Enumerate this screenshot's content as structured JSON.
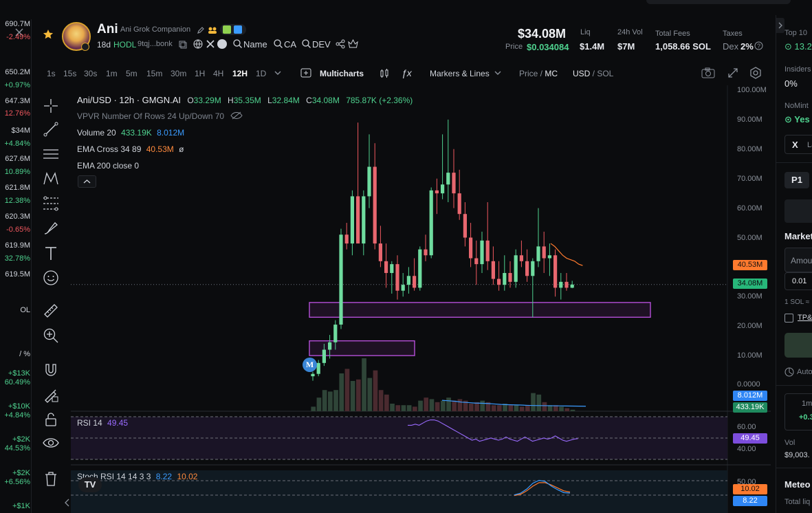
{
  "left_tickers": [
    {
      "text": "690.7M",
      "color": "#cfd3da",
      "top": 28
    },
    {
      "text": "-2.49%",
      "color": "#f0585f",
      "top": 47
    },
    {
      "text": "650.2M",
      "color": "#cfd3da",
      "top": 98
    },
    {
      "text": "+0.97%",
      "color": "#4fd28f",
      "top": 117
    },
    {
      "text": "647.3M",
      "color": "#cfd3da",
      "top": 140
    },
    {
      "text": "12.76%",
      "color": "#f0585f",
      "top": 158
    },
    {
      "text": "$34M",
      "color": "#cfd3da",
      "top": 183
    },
    {
      "text": "+4.84%",
      "color": "#4fd28f",
      "top": 202
    },
    {
      "text": "627.6M",
      "color": "#cfd3da",
      "top": 224
    },
    {
      "text": "10.89%",
      "color": "#4fd28f",
      "top": 243
    },
    {
      "text": "621.8M",
      "color": "#cfd3da",
      "top": 266
    },
    {
      "text": "12.38%",
      "color": "#4fd28f",
      "top": 285
    },
    {
      "text": "620.3M",
      "color": "#cfd3da",
      "top": 308
    },
    {
      "text": "-0.65%",
      "color": "#f0585f",
      "top": 327
    },
    {
      "text": "619.9M",
      "color": "#cfd3da",
      "top": 350
    },
    {
      "text": "32.78%",
      "color": "#4fd28f",
      "top": 369
    },
    {
      "text": "619.5M",
      "color": "#cfd3da",
      "top": 392
    },
    {
      "text": "OL",
      "color": "#cfd3da",
      "top": 444
    },
    {
      "text": "/ %",
      "color": "#cfd3da",
      "top": 508
    },
    {
      "text": "+$13K",
      "color": "#4fd28f",
      "top": 536
    },
    {
      "text": "60.49%",
      "color": "#4fd28f",
      "top": 549
    },
    {
      "text": "+$10K",
      "color": "#4fd28f",
      "top": 584
    },
    {
      "text": "+4.84%",
      "color": "#4fd28f",
      "top": 597
    },
    {
      "text": "+$2K",
      "color": "#4fd28f",
      "top": 632
    },
    {
      "text": "44.53%",
      "color": "#4fd28f",
      "top": 645
    },
    {
      "text": "+$2K",
      "color": "#4fd28f",
      "top": 681
    },
    {
      "text": "+6.56%",
      "color": "#4fd28f",
      "top": 694
    },
    {
      "text": "+$1K",
      "color": "#4fd28f",
      "top": 729
    }
  ],
  "token": {
    "name": "Ani",
    "subtitle": "Ani Grok Companion",
    "age": "18d",
    "hodl": "HODL",
    "address": "9tqj...bonk",
    "name_link": "Name",
    "ca_link": "CA",
    "dev_link": "DEV"
  },
  "stats": {
    "mc": "$34.08M",
    "price_label": "Price",
    "price": "$0.034084",
    "liq_label": "Liq",
    "liq": "$1.4M",
    "vol_label": "24h Vol",
    "vol": "$7M",
    "fees_label": "Total Fees",
    "fees": "1,058.66 SOL",
    "taxes_label": "Taxes",
    "taxes_dex": "Dex",
    "taxes_val": "2%"
  },
  "toolbar": {
    "intervals": [
      "1s",
      "15s",
      "30s",
      "1m",
      "5m",
      "15m",
      "30m",
      "1H",
      "4H",
      "12H",
      "1D"
    ],
    "active_interval": "12H",
    "multicharts": "Multicharts",
    "markers": "Markers & Lines",
    "price_mc_a": "Price / ",
    "price_mc_b": "MC",
    "usd_sol_a": "USD",
    "usd_sol_b": " / SOL"
  },
  "legend": {
    "title": "Ani/USD · 12h · GMGN.AI",
    "o_lbl": "O",
    "o": "33.29M",
    "h_lbl": "H",
    "h": "35.35M",
    "l_lbl": "L",
    "l": "32.84M",
    "c_lbl": "C",
    "c": "34.08M",
    "chg": "785.87K (+2.36%)",
    "vpvr": "VPVR Number Of Rows 24 Up/Down 70",
    "volume_lbl": "Volume 20",
    "volume_a": "433.19K",
    "volume_b": "8.012M",
    "ema_lbl": "EMA Cross 34 89",
    "ema_val": "40.53M",
    "ema_null": "ø",
    "ema200": "EMA 200 close 0",
    "rsi_lbl": "RSI 14",
    "rsi_val": "49.45",
    "stoch_lbl": "Stoch RSI 14 14 3 3",
    "stoch_a": "8.22",
    "stoch_b": "10.02"
  },
  "yaxis": [
    "100.00M",
    "90.00M",
    "80.00M",
    "70.00M",
    "60.00M",
    "50.00M",
    "40.00M",
    "30.00M",
    "20.00M",
    "10.00M",
    "0.0000"
  ],
  "rsi_axis": [
    "60.00",
    "40.00"
  ],
  "stoch_axis": [
    "50.00"
  ],
  "tags": {
    "ema": "40.53M",
    "price": "34.08M",
    "vol_b": "8.012M",
    "vol_a": "433.19K",
    "rsi": "49.45",
    "stoch_b": "10.02",
    "stoch_a": "8.22"
  },
  "right": {
    "top10": "Top 10",
    "top10_val": "13.2",
    "insiders": "Insiders",
    "insiders_val": "0%",
    "nomint": "NoMint",
    "nomint_val": "Yes",
    "x_lbl": "La",
    "p1": "P1",
    "market": "Market",
    "amount": "Amou",
    "amount_val": "0.01",
    "sol_rate": "1 SOL ≈",
    "tp": "TP&",
    "auto": "Auto",
    "period": "1m",
    "period_chg": "+0.3",
    "vol": "Vol",
    "vol_val": "$9,003.",
    "meteora": "Meteo",
    "total_liq": "Total liq"
  },
  "chart_data": {
    "type": "candlestick",
    "ylim": [
      0,
      100000000
    ],
    "candles": [
      [
        3.0,
        4.5,
        1.5,
        3.8
      ],
      [
        3.8,
        8.5,
        3.0,
        7.5
      ],
      [
        7.5,
        14.0,
        6.5,
        12.0
      ],
      [
        12.0,
        17.0,
        9.0,
        14.5
      ],
      [
        14.5,
        22.0,
        12.0,
        20.5
      ],
      [
        20.5,
        53.0,
        19.0,
        51.0
      ],
      [
        51.0,
        55.0,
        46.0,
        48.0
      ],
      [
        48.0,
        66.0,
        44.0,
        64.0
      ],
      [
        64.0,
        89.0,
        55.0,
        48.0
      ],
      [
        48.0,
        66.0,
        44.0,
        64.0
      ],
      [
        64.0,
        85.0,
        60.0,
        74.0
      ],
      [
        74.0,
        82.0,
        46.0,
        48.0
      ],
      [
        48.0,
        54.0,
        40.0,
        42.0
      ],
      [
        42.0,
        48.0,
        33.0,
        38.0
      ],
      [
        38.0,
        42.0,
        31.0,
        41.0
      ],
      [
        41.0,
        44.0,
        29.0,
        32.0
      ],
      [
        32.0,
        38.0,
        30.0,
        34.0
      ],
      [
        34.0,
        40.0,
        31.0,
        37.0
      ],
      [
        37.0,
        43.0,
        32.0,
        33.0
      ],
      [
        33.0,
        47.0,
        32.0,
        46.0
      ],
      [
        46.0,
        51.0,
        42.0,
        44.0
      ],
      [
        44.0,
        67.0,
        43.0,
        66.0
      ],
      [
        66.0,
        70.0,
        58.0,
        65.0
      ],
      [
        65.0,
        85.0,
        63.0,
        68.0
      ],
      [
        68.0,
        90.0,
        62.0,
        72.0
      ],
      [
        72.0,
        80.0,
        60.0,
        65.0
      ],
      [
        65.0,
        73.0,
        56.0,
        58.0
      ],
      [
        58.0,
        62.0,
        47.0,
        50.0
      ],
      [
        50.0,
        55.0,
        40.0,
        43.0
      ],
      [
        43.0,
        49.0,
        34.0,
        41.0
      ],
      [
        41.0,
        52.0,
        38.0,
        49.0
      ],
      [
        49.0,
        62.0,
        39.0,
        42.0
      ],
      [
        42.0,
        47.0,
        34.0,
        36.0
      ],
      [
        36.0,
        42.0,
        32.0,
        34.0
      ],
      [
        34.0,
        44.0,
        32.0,
        38.0
      ],
      [
        38.0,
        42.0,
        33.0,
        35.0
      ],
      [
        35.0,
        46.0,
        33.0,
        44.0
      ],
      [
        44.0,
        49.0,
        40.0,
        42.0
      ],
      [
        42.0,
        46.0,
        35.0,
        37.0
      ],
      [
        37.0,
        43.0,
        23.0,
        42.0
      ],
      [
        42.0,
        60.0,
        40.0,
        47.0
      ],
      [
        47.0,
        52.0,
        38.0,
        43.0
      ],
      [
        43.0,
        48.0,
        37.0,
        44.0
      ],
      [
        44.0,
        46.0,
        30.0,
        33.0
      ],
      [
        33.0,
        38.0,
        29.0,
        35.0
      ],
      [
        35.0,
        38.0,
        32.0,
        33.0
      ],
      [
        33.0,
        35.35,
        32.84,
        34.08
      ]
    ],
    "volumes": [
      3,
      9,
      14,
      13,
      14,
      25,
      28,
      20,
      21,
      35,
      22,
      27,
      14,
      11,
      5,
      4,
      4,
      4,
      3,
      7,
      9,
      8,
      6,
      7,
      9,
      7,
      8,
      7,
      5,
      6,
      7,
      6,
      4,
      4,
      5,
      4,
      4,
      3,
      4,
      12,
      11,
      6,
      4,
      4,
      3,
      2,
      1
    ],
    "ema": [
      48.0,
      47.0,
      45.5,
      44.0,
      43.0,
      42.5,
      42.0,
      41.0,
      40.53
    ],
    "vol_ma": [
      12.0,
      11.5,
      11.0,
      10.0,
      9.5,
      9.0,
      8.8,
      8.5,
      8.0,
      7.5,
      7.2,
      7.0,
      6.8,
      6.5,
      6.3,
      6.2,
      6.1,
      6.0,
      5.9,
      5.8,
      5.7,
      5.6,
      5.5
    ],
    "rsi": [
      62,
      62,
      63,
      62,
      64,
      66,
      67,
      67,
      66,
      64,
      62,
      60,
      58,
      56,
      54,
      52,
      50,
      48,
      49,
      47,
      48,
      49,
      50,
      49,
      48,
      49,
      51,
      49,
      48,
      47,
      49,
      51,
      49,
      47,
      48,
      49,
      50,
      49,
      50,
      52,
      50,
      48,
      47,
      48,
      49,
      49.45
    ],
    "stoch_k": [
      5,
      8,
      15,
      25,
      30,
      28,
      20,
      14,
      9,
      8.22
    ],
    "stoch_d": [
      4,
      6,
      12,
      20,
      26,
      26,
      22,
      17,
      12,
      10.02
    ],
    "zones": [
      {
        "low": 23.0,
        "high": 28.0
      },
      {
        "low": 10.0,
        "high": 15.0
      }
    ]
  }
}
